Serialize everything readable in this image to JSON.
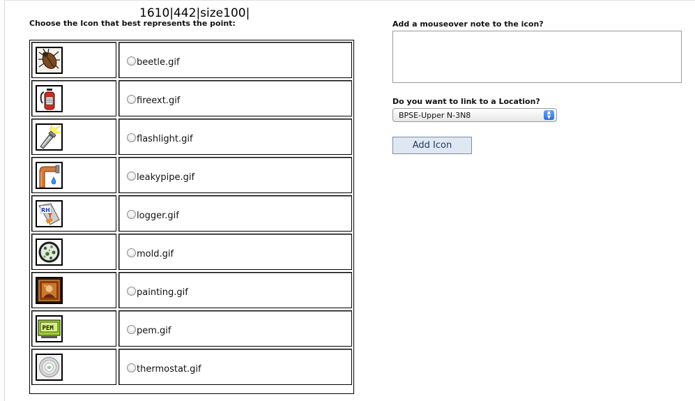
{
  "debug_text": "1610|442|size100|",
  "left_panel": {
    "heading": "Choose the Icon that best represents the point:",
    "icons": [
      {
        "file": "beetle.gif",
        "icon": "beetle-icon"
      },
      {
        "file": "fireext.gif",
        "icon": "fire-extinguisher-icon"
      },
      {
        "file": "flashlight.gif",
        "icon": "flashlight-icon"
      },
      {
        "file": "leakypipe.gif",
        "icon": "leaky-pipe-icon"
      },
      {
        "file": "logger.gif",
        "icon": "logger-icon"
      },
      {
        "file": "mold.gif",
        "icon": "mold-icon"
      },
      {
        "file": "painting.gif",
        "icon": "painting-icon"
      },
      {
        "file": "pem.gif",
        "icon": "pem-icon"
      },
      {
        "file": "thermostat.gif",
        "icon": "thermostat-icon"
      }
    ],
    "logger_badge_text": "RH T",
    "pem_badge_text": "PEM"
  },
  "right_panel": {
    "note_heading": "Add a mouseover note to the icon?",
    "note_value": "",
    "link_heading": "Do you want to link to a Location?",
    "location_selected": "BPSE-Upper N-3N8",
    "add_button_label": "Add Icon"
  }
}
